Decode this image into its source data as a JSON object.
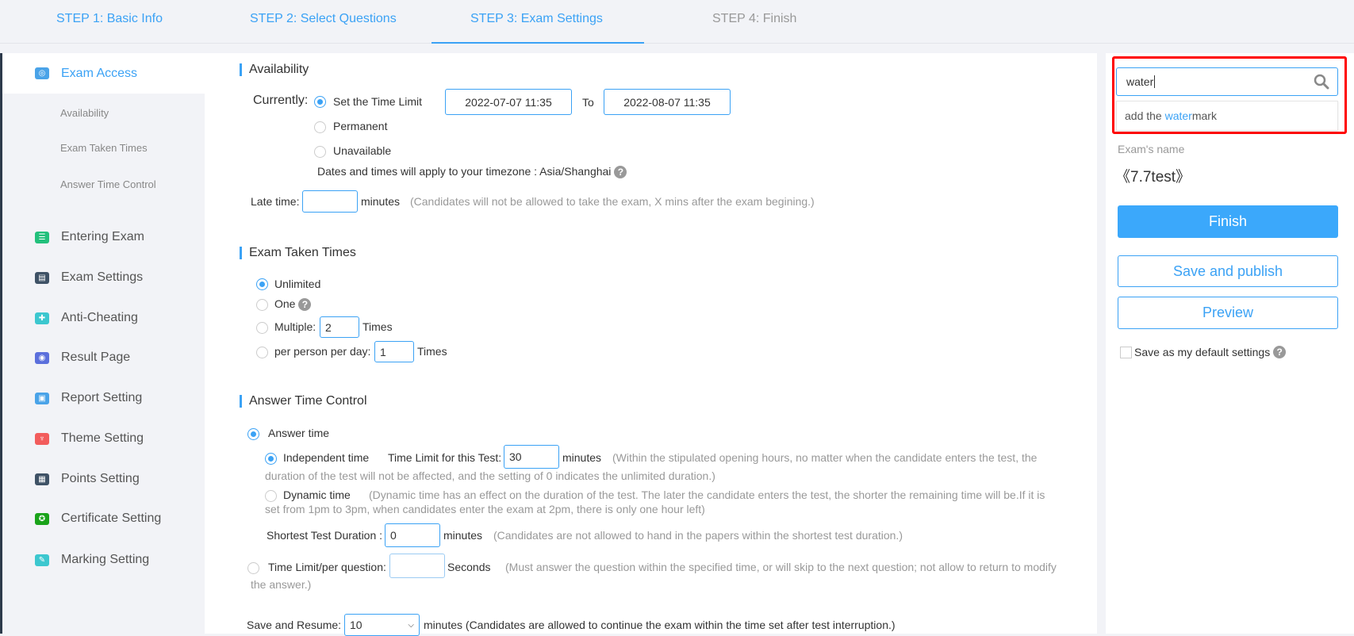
{
  "steps": [
    "STEP 1: Basic Info",
    "STEP 2: Select Questions",
    "STEP 3: Exam Settings",
    "STEP 4: Finish"
  ],
  "sidebar": {
    "active": {
      "label": "Exam Access",
      "icon": "lock-icon",
      "color": "#4aa3e8"
    },
    "sub": [
      "Availability",
      "Exam Taken Times",
      "Answer Time Control"
    ],
    "items": [
      {
        "label": "Entering Exam",
        "icon": "list-icon",
        "color": "#23c07c"
      },
      {
        "label": "Exam Settings",
        "icon": "settings-panel-icon",
        "color": "#3f5266"
      },
      {
        "label": "Anti-Cheating",
        "icon": "shield-icon",
        "color": "#3cc7cf"
      },
      {
        "label": "Result Page",
        "icon": "eye-icon",
        "color": "#5b6fdc"
      },
      {
        "label": "Report Setting",
        "icon": "report-icon",
        "color": "#4aa3e8"
      },
      {
        "label": "Theme Setting",
        "icon": "shirt-icon",
        "color": "#f25c5c"
      },
      {
        "label": "Points Setting",
        "icon": "gift-icon",
        "color": "#3f5266"
      },
      {
        "label": "Certificate Setting",
        "icon": "certificate-icon",
        "color": "#1aa31a"
      },
      {
        "label": "Marking Setting",
        "icon": "marking-icon",
        "color": "#3cc7cf"
      }
    ]
  },
  "availability": {
    "title": "Availability",
    "currently": "Currently:",
    "opt_time_limit": "Set the Time Limit",
    "start": "2022-07-07 11:35",
    "to": "To",
    "end": "2022-08-07 11:35",
    "opt_permanent": "Permanent",
    "opt_unavailable": "Unavailable",
    "timezone_note": "Dates and times will apply to your timezone : Asia/Shanghai",
    "late_label": "Late time:",
    "late_value": "",
    "minutes": "minutes",
    "late_hint": "(Candidates will not be allowed to take the exam, X mins after the exam begining.)"
  },
  "taken": {
    "title": "Exam Taken Times",
    "unlimited": "Unlimited",
    "one": "One",
    "multiple": "Multiple:",
    "multiple_value": "2",
    "times": "Times",
    "per_day": "per person per day:",
    "per_day_value": "1"
  },
  "answer": {
    "title": "Answer Time Control",
    "answer_time": "Answer time",
    "independent": "Independent time",
    "limit_label": "Time Limit for this Test:",
    "limit_value": "30",
    "minutes": "minutes",
    "independent_hint_1": "(Within the stipulated opening hours, no matter when the candidate enters the test, the",
    "independent_hint_2": "duration of the test will not be affected, and the setting of 0 indicates the unlimited duration.)",
    "dynamic": "Dynamic time",
    "dynamic_hint_1": "(Dynamic time has an effect on the duration of the test. The later the candidate enters the test, the shorter the remaining time will be.If it is",
    "dynamic_hint_2": "set from 1pm to 3pm, when candidates enter the exam at 2pm, there is only one hour left)",
    "shortest_label": "Shortest Test Duration :",
    "shortest_value": "0",
    "shortest_hint": "(Candidates are not allowed to hand in the papers within the shortest test duration.)",
    "per_question": "Time Limit/per question:",
    "per_question_value": "",
    "seconds": "Seconds",
    "per_question_hint_1": "(Must answer the question within the specified time, or will skip to the next question; not allow to return to modify",
    "per_question_hint_2": "the answer.)",
    "resume_label": "Save and Resume:",
    "resume_value": "10",
    "resume_hint": "minutes (Candidates are allowed to continue the exam within the time set after test interruption.)"
  },
  "right": {
    "search_value": "water",
    "suggestion_prefix": "add the ",
    "suggestion_match": "water",
    "suggestion_suffix": "mark",
    "exam_name_label": "Exam's name",
    "exam_name": "《7.7test》",
    "finish": "Finish",
    "save_publish": "Save and publish",
    "preview": "Preview",
    "default_settings": "Save as my default settings",
    "accent": "#3ba2f5",
    "highlight": "#ff0000"
  }
}
